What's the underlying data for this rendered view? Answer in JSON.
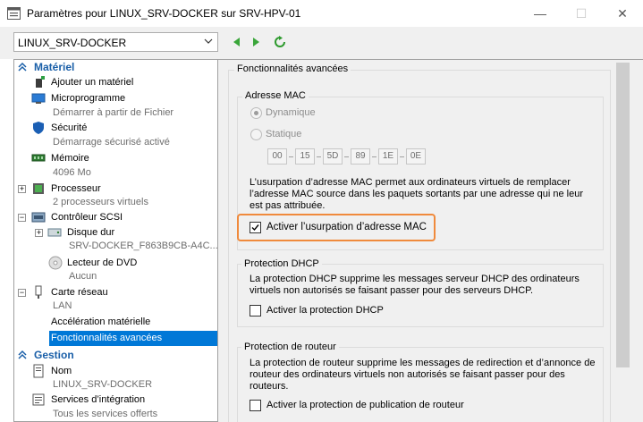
{
  "window": {
    "title": "Paramètres pour LINUX_SRV-DOCKER sur SRV-HPV-01",
    "minimize": "—",
    "maximize": "☐",
    "close": "✕"
  },
  "toolbar": {
    "vm_selected": "LINUX_SRV-DOCKER",
    "icons": [
      "back-arrow",
      "forward-arrow",
      "refresh"
    ]
  },
  "tree": {
    "hardware_header": "Matériel",
    "management_header": "Gestion",
    "items": {
      "add_hardware": {
        "label": "Ajouter un matériel"
      },
      "firmware": {
        "label": "Microprogramme",
        "sub": "Démarrer à partir de Fichier"
      },
      "security": {
        "label": "Sécurité",
        "sub": "Démarrage sécurisé activé"
      },
      "memory": {
        "label": "Mémoire",
        "sub": "4096 Mo"
      },
      "processor": {
        "label": "Processeur",
        "sub": "2 processeurs virtuels"
      },
      "scsi": {
        "label": "Contrôleur SCSI"
      },
      "hard_disk": {
        "label": "Disque dur",
        "sub": "SRV-DOCKER_F863B9CB-A4C..."
      },
      "dvd": {
        "label": "Lecteur de DVD",
        "sub": "Aucun"
      },
      "network": {
        "label": "Carte réseau",
        "sub": "LAN"
      },
      "hw_accel": {
        "label": "Accélération matérielle"
      },
      "advanced": {
        "label": "Fonctionnalités avancées"
      },
      "name": {
        "label": "Nom",
        "sub": "LINUX_SRV-DOCKER"
      },
      "integration": {
        "label": "Services d’intégration",
        "sub": "Tous les services offerts"
      }
    }
  },
  "content": {
    "heading": "Fonctionnalités avancées",
    "mac": {
      "group_title": "Adresse MAC",
      "dynamic_label": "Dynamique",
      "static_label": "Statique",
      "octets": [
        "00",
        "15",
        "5D",
        "89",
        "1E",
        "0E"
      ],
      "description": "L’usurpation d’adresse MAC permet aux ordinateurs virtuels de remplacer l’adresse MAC source dans les paquets sortants par une adresse qui ne leur est pas attribuée.",
      "spoofing_label": "Activer l’usurpation d’adresse MAC",
      "spoofing_checked": true
    },
    "dhcp": {
      "group_title": "Protection DHCP",
      "description": "La protection DHCP supprime les messages serveur DHCP des ordinateurs virtuels non autorisés se faisant passer pour des serveurs DHCP.",
      "checkbox_label": "Activer la protection DHCP",
      "checked": false
    },
    "router": {
      "group_title": "Protection de routeur",
      "description": "La protection de routeur supprime les messages de redirection et d’annonce de routeur des ordinateurs virtuels non autorisés se faisant passer pour des routeurs.",
      "checkbox_label": "Activer la protection de publication de routeur",
      "checked": false
    }
  },
  "colors": {
    "accent": "#0078d7",
    "highlight": "#f08a3c",
    "section_header": "#1a5fa8"
  }
}
